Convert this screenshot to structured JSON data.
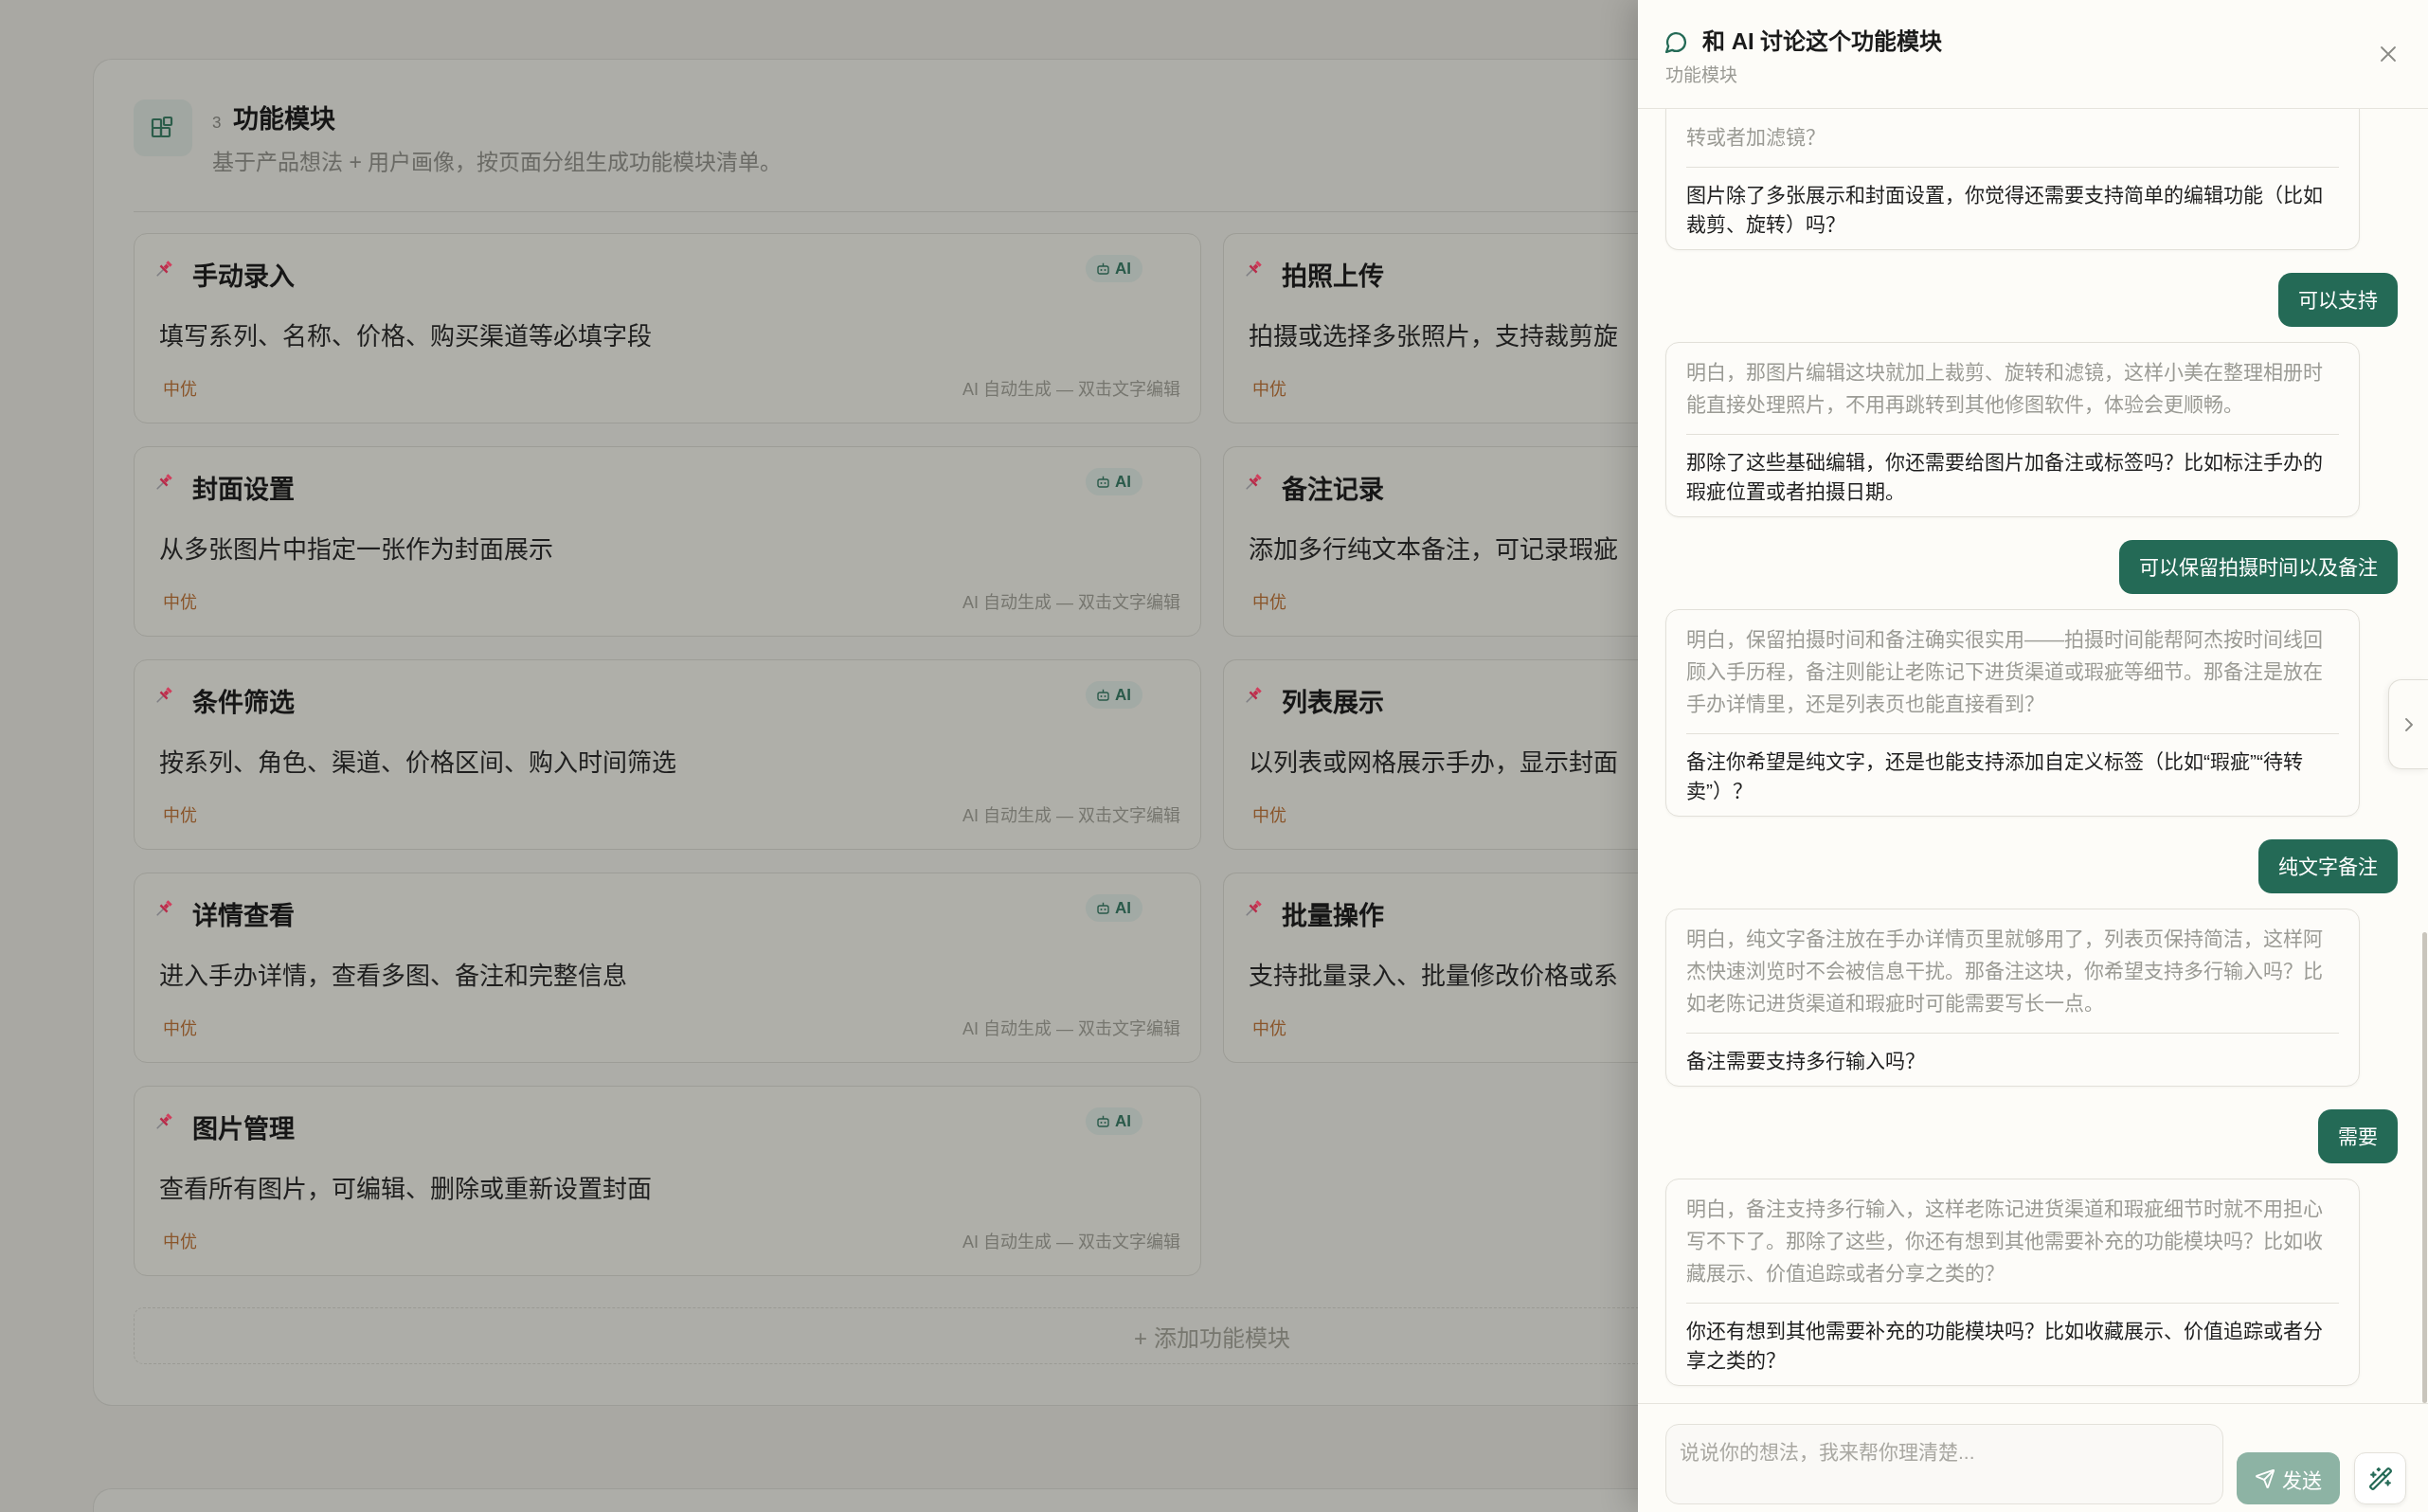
{
  "module_section": {
    "step": "3",
    "title": "功能模块",
    "subtitle": "基于产品想法 + 用户画像，按页面分组生成功能模块清单。",
    "modules": [
      {
        "title": "手动录入",
        "description": "填写系列、名称、价格、购买渠道等必填字段",
        "priority": "中优",
        "badge": "AI",
        "note": "AI 自动生成 — 双击文字编辑"
      },
      {
        "title": "拍照上传",
        "description": "拍摄或选择多张照片，支持裁剪旋",
        "priority": "中优"
      },
      {
        "title": "封面设置",
        "description": "从多张图片中指定一张作为封面展示",
        "priority": "中优",
        "badge": "AI",
        "note": "AI 自动生成 — 双击文字编辑"
      },
      {
        "title": "备注记录",
        "description": "添加多行纯文本备注，可记录瑕疵",
        "priority": "中优"
      },
      {
        "title": "条件筛选",
        "description": "按系列、角色、渠道、价格区间、购入时间筛选",
        "priority": "中优",
        "badge": "AI",
        "note": "AI 自动生成 — 双击文字编辑"
      },
      {
        "title": "列表展示",
        "description": "以列表或网格展示手办，显示封面",
        "priority": "中优"
      },
      {
        "title": "详情查看",
        "description": "进入手办详情，查看多图、备注和完整信息",
        "priority": "中优",
        "badge": "AI",
        "note": "AI 自动生成 — 双击文字编辑"
      },
      {
        "title": "批量操作",
        "description": "支持批量录入、批量修改价格或系",
        "priority": "中优"
      },
      {
        "title": "图片管理",
        "description": "查看所有图片，可编辑、删除或重新设置封面",
        "priority": "中优",
        "badge": "AI",
        "note": "AI 自动生成 — 双击文字编辑"
      }
    ],
    "add_button": "+ 添加功能模块"
  },
  "chat_drawer": {
    "title": "和 AI 讨论这个功能模块",
    "subtitle": "功能模块",
    "messages": [
      {
        "kind": "ai",
        "reply": "转或者加滤镜？",
        "question": "图片除了多张展示和封面设置，你觉得还需要支持简单的编辑功能（比如裁剪、旋转）吗？"
      },
      {
        "kind": "user",
        "text": "可以支持"
      },
      {
        "kind": "ai",
        "reply": "明白，那图片编辑这块就加上裁剪、旋转和滤镜，这样小美在整理相册时能直接处理照片，不用再跳转到其他修图软件，体验会更顺畅。",
        "question": "那除了这些基础编辑，你还需要给图片加备注或标签吗？比如标注手办的瑕疵位置或者拍摄日期。"
      },
      {
        "kind": "user",
        "text": "可以保留拍摄时间以及备注"
      },
      {
        "kind": "ai",
        "reply": "明白，保留拍摄时间和备注确实很实用——拍摄时间能帮阿杰按时间线回顾入手历程，备注则能让老陈记下进货渠道或瑕疵等细节。那备注是放在手办详情里，还是列表页也能直接看到？",
        "question": "备注你希望是纯文字，还是也能支持添加自定义标签（比如“瑕疵”“待转卖”）？"
      },
      {
        "kind": "user",
        "text": "纯文字备注"
      },
      {
        "kind": "ai",
        "reply": "明白，纯文字备注放在手办详情页里就够用了，列表页保持简洁，这样阿杰快速浏览时不会被信息干扰。那备注这块，你希望支持多行输入吗？比如老陈记进货渠道和瑕疵时可能需要写长一点。",
        "question": "备注需要支持多行输入吗？"
      },
      {
        "kind": "user",
        "text": "需要"
      },
      {
        "kind": "ai",
        "reply": "明白，备注支持多行输入，这样老陈记进货渠道和瑕疵细节时就不用担心写不下了。那除了这些，你还有想到其他需要补充的功能模块吗？比如收藏展示、价值追踪或者分享之类的？",
        "question": "你还有想到其他需要补充的功能模块吗？比如收藏展示、价值追踪或者分享之类的？"
      }
    ],
    "input": {
      "placeholder": "说说你的想法，我来帮你理清楚..."
    },
    "send_button": {
      "label": "发送",
      "disabled": true
    }
  }
}
